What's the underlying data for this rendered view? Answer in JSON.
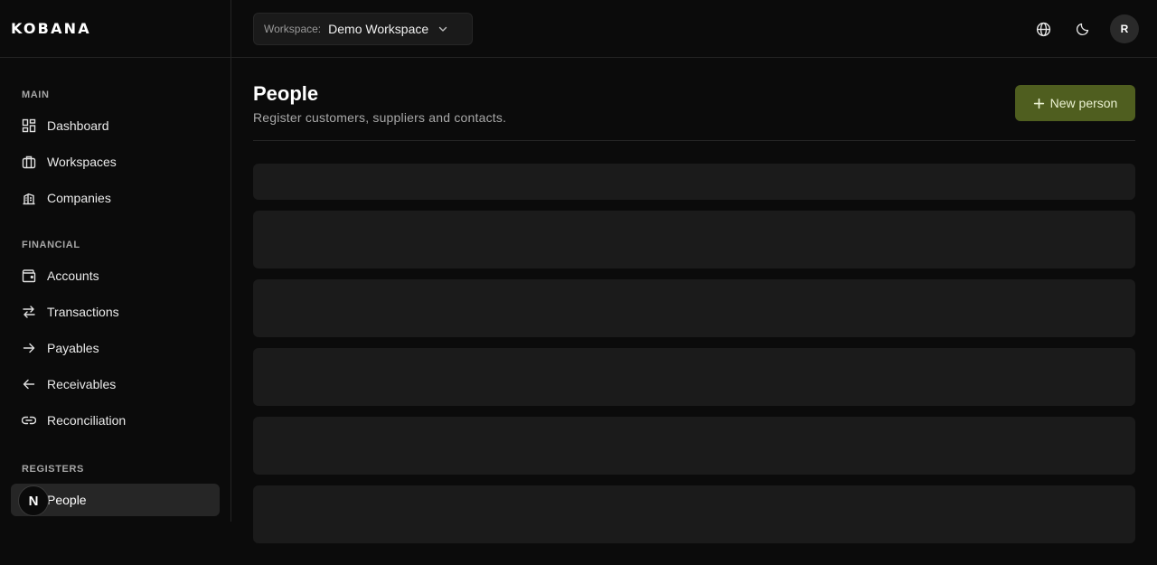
{
  "brand": {
    "logo": "KOBANA"
  },
  "workspace": {
    "prefix": "Workspace:",
    "value": "Demo Workspace"
  },
  "user": {
    "initial": "R"
  },
  "sidebar": {
    "sections": [
      {
        "title": "MAIN",
        "items": [
          {
            "label": "Dashboard",
            "icon": "dashboard-icon"
          },
          {
            "label": "Workspaces",
            "icon": "briefcase-icon"
          },
          {
            "label": "Companies",
            "icon": "building-icon"
          }
        ]
      },
      {
        "title": "FINANCIAL",
        "items": [
          {
            "label": "Accounts",
            "icon": "wallet-icon"
          },
          {
            "label": "Transactions",
            "icon": "arrows-left-right-icon"
          },
          {
            "label": "Payables",
            "icon": "arrow-right-icon"
          },
          {
            "label": "Receivables",
            "icon": "arrow-left-icon"
          },
          {
            "label": "Reconciliation",
            "icon": "link-icon"
          }
        ]
      },
      {
        "title": "REGISTERS",
        "items": [
          {
            "label": "People",
            "icon": "people-icon",
            "active": true
          }
        ]
      }
    ],
    "overlay_badge": "N"
  },
  "page": {
    "title": "People",
    "subtitle": "Register customers, suppliers and contacts.",
    "new_button": "New person"
  },
  "colors": {
    "background": "#0b0b0b",
    "accent_button": "#4f5e1f",
    "active_nav": "#262626",
    "skeleton": "#1b1b1b"
  }
}
